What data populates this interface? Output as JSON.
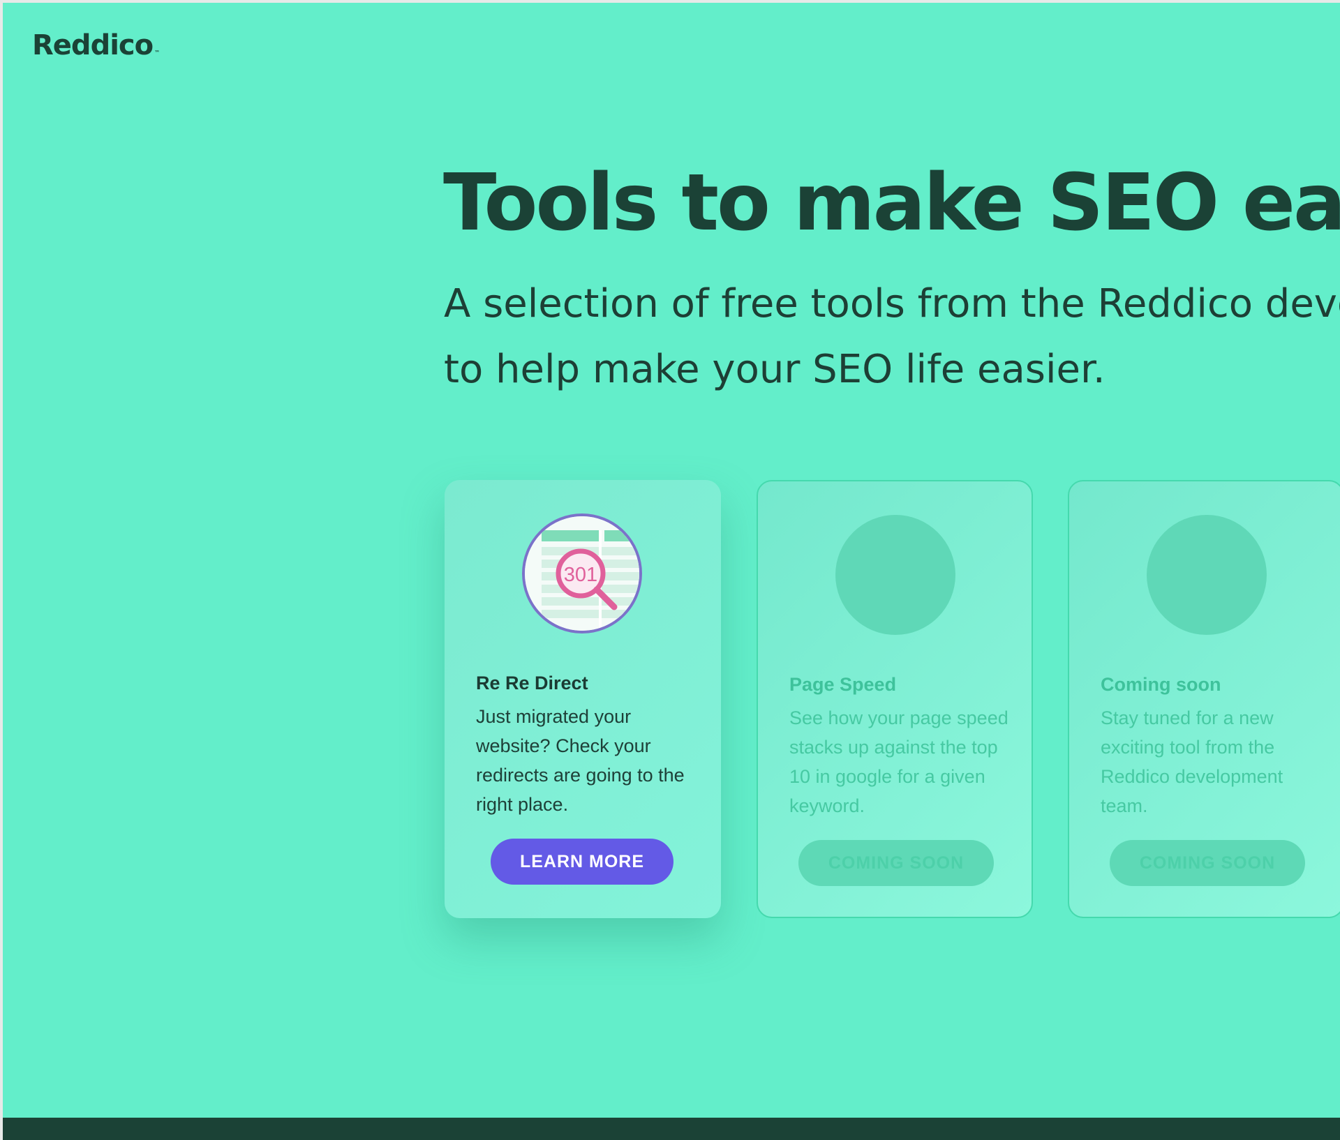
{
  "brand": {
    "logo": "Reddico",
    "trademark": "™"
  },
  "hero": {
    "headline": "Tools to make SEO eas",
    "subtitle_line1": "A selection of free tools from the Reddico devel",
    "subtitle_line2": "to help make your SEO life easier."
  },
  "cards": [
    {
      "title": "Re Re Direct",
      "description": "Just migrated your website? Check your redirects are going to the right place.",
      "button": "LEARN MORE",
      "icon": "redirect-search-icon",
      "icon_text": "301",
      "state": "active"
    },
    {
      "title": "Page Speed",
      "description": "See how your page speed stacks up against the top 10 in google for a given keyword.",
      "button": "COMING SOON",
      "icon": "placeholder-circle",
      "state": "disabled"
    },
    {
      "title": "Coming soon",
      "description": "Stay tuned for a new exciting tool from the Reddico development team.",
      "button": "COMING SOON",
      "icon": "placeholder-circle",
      "state": "disabled"
    }
  ],
  "colors": {
    "background": "#63eeca",
    "text_dark": "#1b4236",
    "primary_button": "#635ae6",
    "magnifier": "#e0609b"
  }
}
